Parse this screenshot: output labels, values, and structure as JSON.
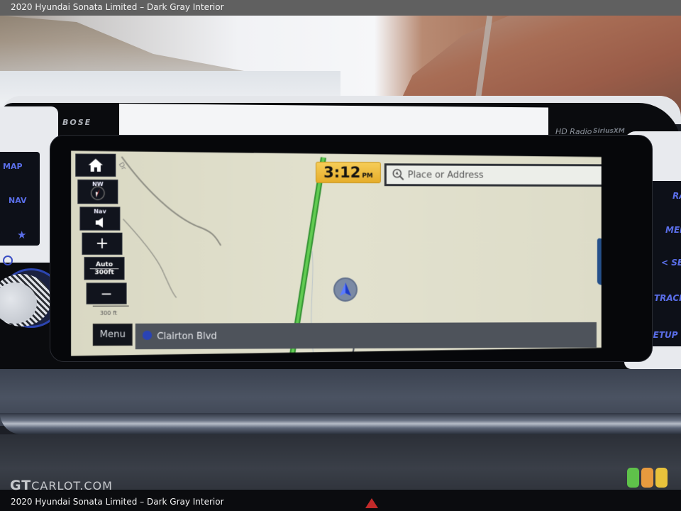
{
  "caption": {
    "top": "2020 Hyundai Sonata Limited – Dark Gray Interior",
    "bottom": "2020 Hyundai Sonata Limited – Dark Gray Interior",
    "watermark_prefix": "GT",
    "watermark_suffix": "CARLOT.COM"
  },
  "hardware": {
    "brand_audio": "BOSE",
    "hd_radio": "HD Radio",
    "sirius": "SiriusXM",
    "left_keys": [
      {
        "label": "MAP",
        "icon": "map"
      },
      {
        "label": "NAV",
        "icon": "nav"
      },
      {
        "label": "★",
        "icon": "star-icon"
      }
    ],
    "right_keys": [
      {
        "label": "RADIO"
      },
      {
        "label": "MEDIA"
      },
      {
        "label": "< SEEK"
      },
      {
        "label": "TRACK >"
      },
      {
        "label": "SETUP"
      }
    ]
  },
  "nav": {
    "controls": {
      "home_icon": "home-icon",
      "compass_label": "NW",
      "nav_volume_label": "Nav",
      "zoom_in": "+",
      "zoom_mode": "Auto",
      "zoom_scale": "300ft",
      "zoom_out": "−",
      "scale_label": "300 ft"
    },
    "clock": {
      "time": "3:12",
      "ampm": "PM"
    },
    "search": {
      "placeholder": "Place or Address"
    },
    "menu_label": "Menu",
    "current_road": "Clairton Blvd",
    "map_label": "Dr",
    "colors": {
      "map_bg": "#e0dfcc",
      "route": "#3aa63a",
      "clock_bg": "#f2c14a",
      "side_tab": "#25508a",
      "key_text": "#5a6ee8"
    }
  },
  "logo_colors": [
    "#5fc24a",
    "#e79a3e",
    "#e8c23b"
  ]
}
